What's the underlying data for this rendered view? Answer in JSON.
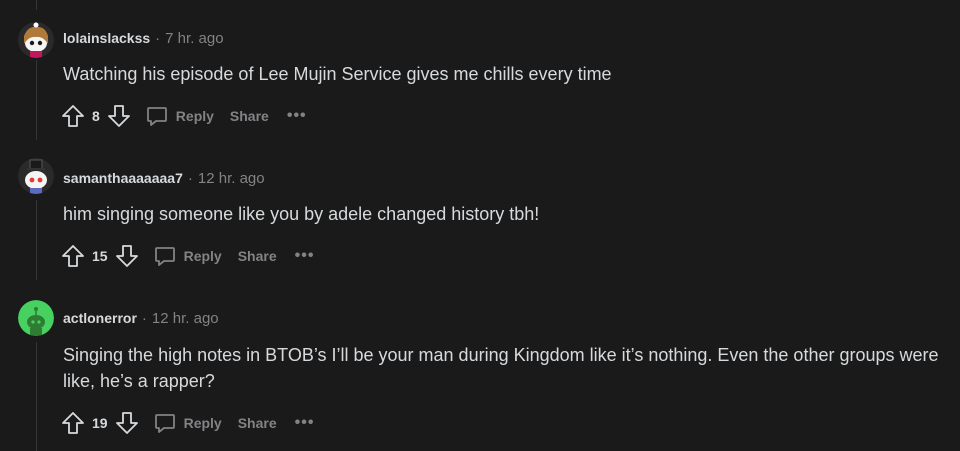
{
  "comments": [
    {
      "author": "lolainslackss",
      "time": "7 hr. ago",
      "body": "Watching his episode of Lee Mujin Service gives me chills every time",
      "score": "8",
      "reply_label": "Reply",
      "share_label": "Share",
      "more_label": "•••",
      "avatar_bg": "#1a1a1b",
      "avatar_accent": "#b4ffe0"
    },
    {
      "author": "samanthaaaaaaa7",
      "time": "12 hr. ago",
      "body": "him singing someone like you by adele changed history tbh!",
      "score": "15",
      "reply_label": "Reply",
      "share_label": "Share",
      "more_label": "•••",
      "avatar_bg": "#1a1a1b",
      "avatar_accent": "#ffffff"
    },
    {
      "author": "actlonerror",
      "time": "12 hr. ago",
      "body": "Singing the high notes in BTOB’s I’ll be your man during Kingdom like it’s nothing. Even the other groups were like, he’s a rapper?",
      "score": "19",
      "reply_label": "Reply",
      "share_label": "Share",
      "more_label": "•••",
      "avatar_bg": "#46d160",
      "avatar_accent": "#2e7d32"
    }
  ],
  "separator": "·"
}
